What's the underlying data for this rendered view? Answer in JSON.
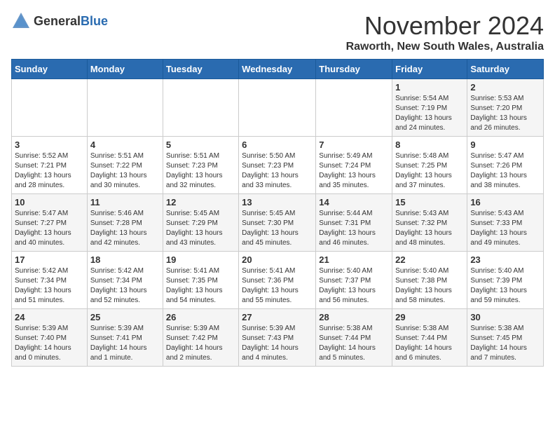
{
  "logo": {
    "text_general": "General",
    "text_blue": "Blue"
  },
  "title": "November 2024",
  "location": "Raworth, New South Wales, Australia",
  "headers": [
    "Sunday",
    "Monday",
    "Tuesday",
    "Wednesday",
    "Thursday",
    "Friday",
    "Saturday"
  ],
  "weeks": [
    [
      {
        "day": "",
        "info": ""
      },
      {
        "day": "",
        "info": ""
      },
      {
        "day": "",
        "info": ""
      },
      {
        "day": "",
        "info": ""
      },
      {
        "day": "",
        "info": ""
      },
      {
        "day": "1",
        "info": "Sunrise: 5:54 AM\nSunset: 7:19 PM\nDaylight: 13 hours\nand 24 minutes."
      },
      {
        "day": "2",
        "info": "Sunrise: 5:53 AM\nSunset: 7:20 PM\nDaylight: 13 hours\nand 26 minutes."
      }
    ],
    [
      {
        "day": "3",
        "info": "Sunrise: 5:52 AM\nSunset: 7:21 PM\nDaylight: 13 hours\nand 28 minutes."
      },
      {
        "day": "4",
        "info": "Sunrise: 5:51 AM\nSunset: 7:22 PM\nDaylight: 13 hours\nand 30 minutes."
      },
      {
        "day": "5",
        "info": "Sunrise: 5:51 AM\nSunset: 7:23 PM\nDaylight: 13 hours\nand 32 minutes."
      },
      {
        "day": "6",
        "info": "Sunrise: 5:50 AM\nSunset: 7:23 PM\nDaylight: 13 hours\nand 33 minutes."
      },
      {
        "day": "7",
        "info": "Sunrise: 5:49 AM\nSunset: 7:24 PM\nDaylight: 13 hours\nand 35 minutes."
      },
      {
        "day": "8",
        "info": "Sunrise: 5:48 AM\nSunset: 7:25 PM\nDaylight: 13 hours\nand 37 minutes."
      },
      {
        "day": "9",
        "info": "Sunrise: 5:47 AM\nSunset: 7:26 PM\nDaylight: 13 hours\nand 38 minutes."
      }
    ],
    [
      {
        "day": "10",
        "info": "Sunrise: 5:47 AM\nSunset: 7:27 PM\nDaylight: 13 hours\nand 40 minutes."
      },
      {
        "day": "11",
        "info": "Sunrise: 5:46 AM\nSunset: 7:28 PM\nDaylight: 13 hours\nand 42 minutes."
      },
      {
        "day": "12",
        "info": "Sunrise: 5:45 AM\nSunset: 7:29 PM\nDaylight: 13 hours\nand 43 minutes."
      },
      {
        "day": "13",
        "info": "Sunrise: 5:45 AM\nSunset: 7:30 PM\nDaylight: 13 hours\nand 45 minutes."
      },
      {
        "day": "14",
        "info": "Sunrise: 5:44 AM\nSunset: 7:31 PM\nDaylight: 13 hours\nand 46 minutes."
      },
      {
        "day": "15",
        "info": "Sunrise: 5:43 AM\nSunset: 7:32 PM\nDaylight: 13 hours\nand 48 minutes."
      },
      {
        "day": "16",
        "info": "Sunrise: 5:43 AM\nSunset: 7:33 PM\nDaylight: 13 hours\nand 49 minutes."
      }
    ],
    [
      {
        "day": "17",
        "info": "Sunrise: 5:42 AM\nSunset: 7:34 PM\nDaylight: 13 hours\nand 51 minutes."
      },
      {
        "day": "18",
        "info": "Sunrise: 5:42 AM\nSunset: 7:34 PM\nDaylight: 13 hours\nand 52 minutes."
      },
      {
        "day": "19",
        "info": "Sunrise: 5:41 AM\nSunset: 7:35 PM\nDaylight: 13 hours\nand 54 minutes."
      },
      {
        "day": "20",
        "info": "Sunrise: 5:41 AM\nSunset: 7:36 PM\nDaylight: 13 hours\nand 55 minutes."
      },
      {
        "day": "21",
        "info": "Sunrise: 5:40 AM\nSunset: 7:37 PM\nDaylight: 13 hours\nand 56 minutes."
      },
      {
        "day": "22",
        "info": "Sunrise: 5:40 AM\nSunset: 7:38 PM\nDaylight: 13 hours\nand 58 minutes."
      },
      {
        "day": "23",
        "info": "Sunrise: 5:40 AM\nSunset: 7:39 PM\nDaylight: 13 hours\nand 59 minutes."
      }
    ],
    [
      {
        "day": "24",
        "info": "Sunrise: 5:39 AM\nSunset: 7:40 PM\nDaylight: 14 hours\nand 0 minutes."
      },
      {
        "day": "25",
        "info": "Sunrise: 5:39 AM\nSunset: 7:41 PM\nDaylight: 14 hours\nand 1 minute."
      },
      {
        "day": "26",
        "info": "Sunrise: 5:39 AM\nSunset: 7:42 PM\nDaylight: 14 hours\nand 2 minutes."
      },
      {
        "day": "27",
        "info": "Sunrise: 5:39 AM\nSunset: 7:43 PM\nDaylight: 14 hours\nand 4 minutes."
      },
      {
        "day": "28",
        "info": "Sunrise: 5:38 AM\nSunset: 7:44 PM\nDaylight: 14 hours\nand 5 minutes."
      },
      {
        "day": "29",
        "info": "Sunrise: 5:38 AM\nSunset: 7:44 PM\nDaylight: 14 hours\nand 6 minutes."
      },
      {
        "day": "30",
        "info": "Sunrise: 5:38 AM\nSunset: 7:45 PM\nDaylight: 14 hours\nand 7 minutes."
      }
    ]
  ]
}
